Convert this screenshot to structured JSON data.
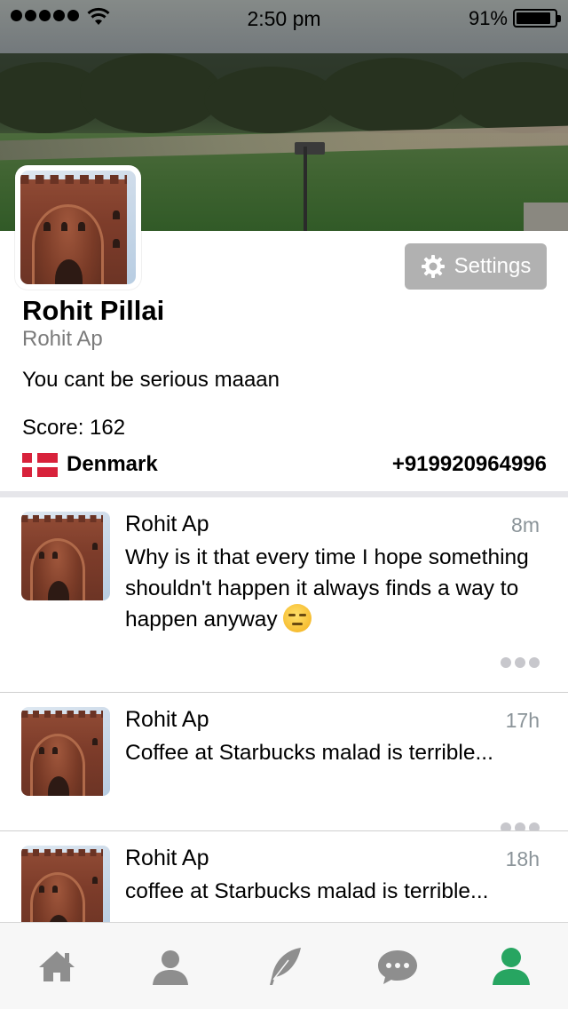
{
  "status_bar": {
    "time": "2:50 pm",
    "battery_percent": "91%",
    "signal_bars": 5,
    "battery_level": 0.91
  },
  "profile": {
    "name": "Rohit Pillai",
    "username": "Rohit Ap",
    "bio": "You cant be serious maaan",
    "score_label": "Score: 162",
    "country": "Denmark",
    "phone": "+919920964996",
    "settings_label": "Settings",
    "settings_icon": "gear-icon"
  },
  "posts": [
    {
      "author": "Rohit Ap",
      "time": "8m",
      "text": "Why is it that every time I hope something shouldn't happen it always finds a way to happen anyway",
      "emoji": "unamused-face"
    },
    {
      "author": "Rohit Ap",
      "time": "17h",
      "text": "Coffee at Starbucks malad is terrible..."
    },
    {
      "author": "Rohit Ap",
      "time": "18h",
      "text": "coffee at Starbucks malad is terrible..."
    }
  ],
  "tab_bar": {
    "tabs": [
      {
        "icon": "home-icon",
        "active": false
      },
      {
        "icon": "person-icon",
        "active": false
      },
      {
        "icon": "feather-icon",
        "active": false
      },
      {
        "icon": "chat-bubble-icon",
        "active": false
      },
      {
        "icon": "profile-icon",
        "active": true
      }
    ],
    "active_color": "#27a561",
    "inactive_color": "#8e8e8e"
  },
  "colors": {
    "settings_button_bg": "#b1b1b1",
    "secondary_text": "#7b7b7b",
    "timestamp": "#8b9499",
    "flag_red": "#d8223b"
  }
}
